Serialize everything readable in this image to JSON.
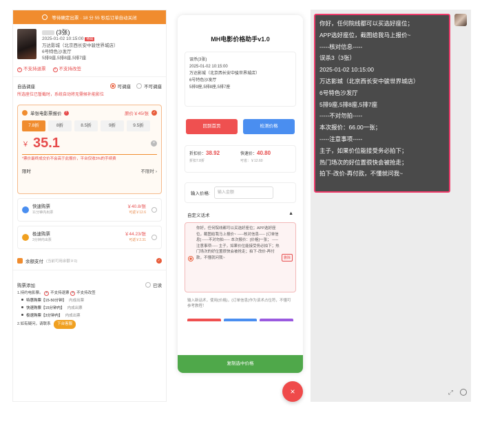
{
  "left": {
    "topbar": "等待确定出票 · 18 分 55 秒后订单自动关闭",
    "order": {
      "title": "(3张)",
      "tag": "待出",
      "datetime": "2025-01-02 10:15:00",
      "cinema": "万达影城（北京西长安中骏世界城店）",
      "hall": "6号特色沙发厅",
      "seats": "5排9座,5排8座,5排7座"
    },
    "rules": [
      "不支持退票",
      "不支持改签"
    ],
    "adjust": {
      "label": "自选调座",
      "opt_yes": "可调座",
      "opt_no": "不可调座"
    },
    "warning": "所选座位已暂截时，系统自动将无需候补能影位",
    "main_card": {
      "title": "单张电影票报价",
      "orig": "原价￥45/张",
      "discounts": [
        "7.8折",
        "8折",
        "8.5折",
        "9折",
        "9.5折"
      ],
      "yen": "￥",
      "price": "35.1",
      "note": "*票价最终成交价不会高于此报价，平台仅收3%的手续费",
      "limit_label": "限时",
      "limit_value": "不限时"
    },
    "options": [
      {
        "title": "快速购票",
        "sub": "11分钟内出票",
        "price": "￥40.8/张",
        "sub_price": "可返￥12.6",
        "color": "#4a8ef0"
      },
      {
        "title": "极速购票",
        "sub": "3分钟内出票",
        "price": "￥44.23/张",
        "sub_price": "可返￥2.31",
        "color": "#f0a020"
      }
    ],
    "balance": {
      "label": "余额支付",
      "sub": "(当前可用余额￥0)"
    },
    "buy": {
      "title": "购票添加",
      "opt": "已读",
      "rule1_prefix": "1.持约电影票。",
      "rule1_a": "不支持退票",
      "rule1_b": "不支持改签",
      "items": [
        {
          "name": "特惠购票",
          "time": "【15-50分钟】",
          "hint": "内成出票"
        },
        {
          "name": "快速购票",
          "time": "【15分钟内】",
          "hint": "内成出票"
        },
        {
          "name": "极速购票",
          "time": "【3分钟内】",
          "hint": "内成出票"
        }
      ],
      "rule2": "2.如有疑问，请联系",
      "copy_btn": "下台客服"
    }
  },
  "mid": {
    "title": "MH电影价格助手v1.0",
    "card_lines": [
      "误杀(3张)",
      "2025-01-02 10:15:00",
      "万达影城（北京西长安中骏世界城店）",
      "6号特色沙发厅",
      "5排9座,5排8座,5排7座"
    ],
    "btn_home": "回到首页",
    "btn_check": "检测价格",
    "p1_label": "折扣价：",
    "p1_value": "38.92",
    "p1_sub": "折扣7.8折",
    "p2_label": "快速价：",
    "p2_value": "40.80",
    "p2_sub": "可省：￥12.60",
    "input_label": "输入价格:",
    "input_placeholder": "输入金额",
    "script_title": "自定义话术",
    "script_text": "你好，任何院线都可以买选好座位；APP选好座位，截图给我马上报价~ -----核对信息----- [订单信息] -----不对勿拍----- 本次报价：[价格]一张； -----注意事项----- 主子，如果价位能接受务必拍下；热门场次的好位置很快会被抢走；拍下-改价-再付款，不懂就问我~",
    "del": "删除",
    "new_script": "输入新话术，使用{价格}，{订单信息}作为该术占位符，不懂可参考教程！",
    "green_btn": "复制选中价格",
    "fab": "×"
  },
  "right": {
    "bubble_lines": [
      "你好，任何院线都可以买选好座位；",
      "APP选好座位，截图给我马上报价~",
      "-----核对信息-----",
      "误杀3（3张）",
      "2025-01-02 10:15:00",
      "万达影城（北京西长安中骏世界城店）",
      "6号特色沙发厅",
      "5排9座,5排8座,5排7座",
      "-----不对勿拍-----",
      "本次报价：66.00一张；",
      "-----注意事项-----",
      "主子，如果价位能接受务必拍下；",
      "热门场次的好位置很快会被抢走；",
      "拍下-改价-再付款，不懂就问我~"
    ]
  }
}
